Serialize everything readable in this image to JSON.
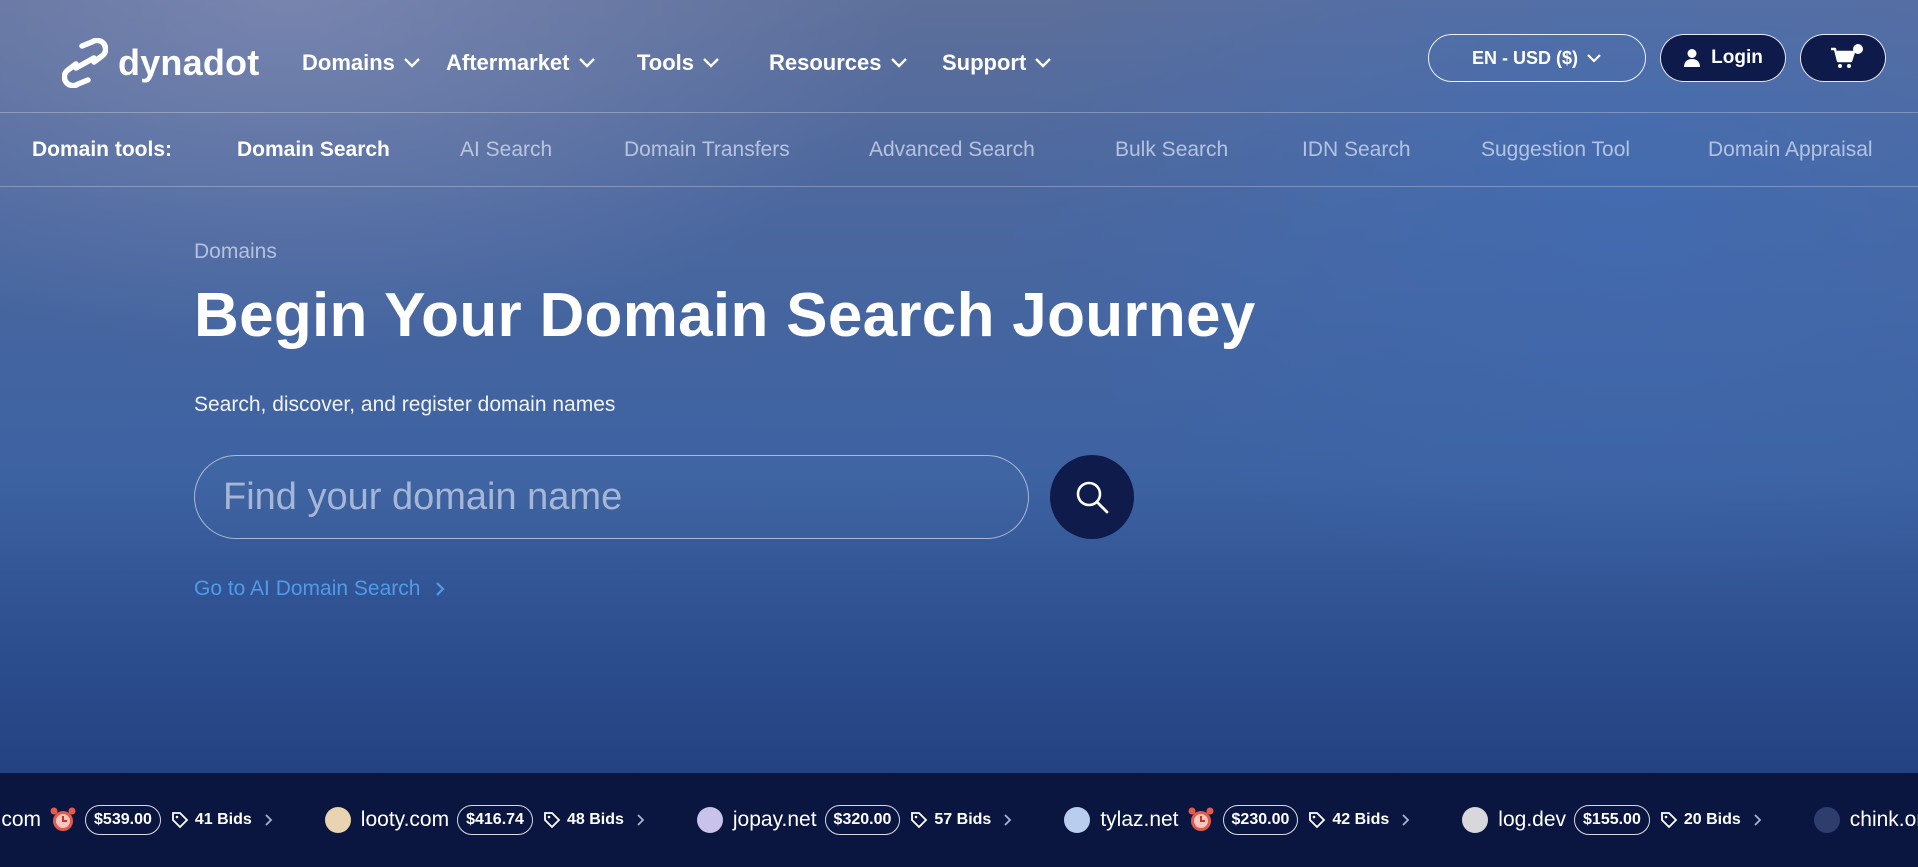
{
  "brand": {
    "name": "dynadot",
    "icon": "link-chain-logo-icon"
  },
  "nav": {
    "items": [
      {
        "label": "Domains"
      },
      {
        "label": "Aftermarket"
      },
      {
        "label": "Tools"
      },
      {
        "label": "Resources"
      },
      {
        "label": "Support"
      }
    ]
  },
  "header": {
    "locale_label": "EN - USD ($)",
    "login_label": "Login",
    "icons": [
      "chevron-down-icon",
      "user-icon",
      "cart-icon"
    ]
  },
  "subnav": {
    "label": "Domain tools:",
    "items": [
      {
        "label": "Domain Search",
        "active": true
      },
      {
        "label": "AI Search",
        "active": false
      },
      {
        "label": "Domain Transfers",
        "active": false
      },
      {
        "label": "Advanced Search",
        "active": false
      },
      {
        "label": "Bulk Search",
        "active": false
      },
      {
        "label": "IDN Search",
        "active": false
      },
      {
        "label": "Suggestion Tool",
        "active": false
      },
      {
        "label": "Domain Appraisal",
        "active": false
      }
    ]
  },
  "hero": {
    "breadcrumb": "Domains",
    "title": "Begin Your Domain Search Journey",
    "subtitle": "Search, discover, and register domain names",
    "search_placeholder": "Find your domain name",
    "search_value": "",
    "ai_link": "Go to AI Domain Search"
  },
  "ticker": {
    "items": [
      {
        "domain": "ot.com",
        "price": "$539.00",
        "bids": "41 Bids",
        "alarm": true,
        "dot_color": ""
      },
      {
        "domain": "looty.com",
        "price": "$416.74",
        "bids": "48 Bids",
        "alarm": false,
        "dot_color": "#e9d3b0"
      },
      {
        "domain": "jopay.net",
        "price": "$320.00",
        "bids": "57 Bids",
        "alarm": false,
        "dot_color": "#c9c2ea"
      },
      {
        "domain": "tylaz.net",
        "price": "$230.00",
        "bids": "42 Bids",
        "alarm": true,
        "dot_color": "#b9cdee"
      },
      {
        "domain": "log.dev",
        "price": "$155.00",
        "bids": "20 Bids",
        "alarm": false,
        "dot_color": "#d8d8dc"
      },
      {
        "domain": "chink.org",
        "price": "",
        "bids": "",
        "alarm": false,
        "dot_color": "#2c3d6e"
      }
    ]
  },
  "colors": {
    "accent_link": "#4f9be8",
    "navy_button": "#0e1b4b",
    "ticker_bg": "#0b1640",
    "alarm_red": "#e45a4c"
  }
}
